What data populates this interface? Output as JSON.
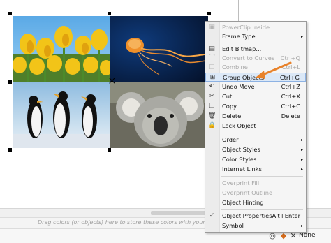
{
  "canvas": {
    "images": [
      {
        "name": "tulips"
      },
      {
        "name": "jellyfish"
      },
      {
        "name": "penguins"
      },
      {
        "name": "koala"
      }
    ]
  },
  "context_menu": {
    "items": [
      {
        "label": "PowerClip Inside...",
        "shortcut": "",
        "submenu": false,
        "disabled": true,
        "icon": "powerclip-icon"
      },
      {
        "label": "Frame Type",
        "shortcut": "",
        "submenu": true,
        "disabled": false,
        "icon": ""
      },
      {
        "label": "Edit Bitmap...",
        "shortcut": "",
        "submenu": false,
        "disabled": false,
        "icon": "edit-bitmap-icon"
      },
      {
        "label": "Convert to Curves",
        "shortcut": "Ctrl+Q",
        "submenu": false,
        "disabled": true,
        "icon": "convert-curves-icon"
      },
      {
        "label": "Combine",
        "shortcut": "Ctrl+L",
        "submenu": false,
        "disabled": true,
        "icon": "combine-icon"
      },
      {
        "label": "Group Objects",
        "shortcut": "Ctrl+G",
        "submenu": false,
        "disabled": false,
        "icon": "group-objects-icon",
        "highlighted": true
      },
      {
        "label": "Undo Move",
        "shortcut": "Ctrl+Z",
        "submenu": false,
        "disabled": false,
        "icon": "undo-icon"
      },
      {
        "label": "Cut",
        "shortcut": "Ctrl+X",
        "submenu": false,
        "disabled": false,
        "icon": "scissors-icon"
      },
      {
        "label": "Copy",
        "shortcut": "Ctrl+C",
        "submenu": false,
        "disabled": false,
        "icon": "copy-icon"
      },
      {
        "label": "Delete",
        "shortcut": "Delete",
        "submenu": false,
        "disabled": false,
        "icon": "trash-icon"
      },
      {
        "label": "Lock Object",
        "shortcut": "",
        "submenu": false,
        "disabled": false,
        "icon": "lock-icon"
      },
      {
        "label": "Order",
        "shortcut": "",
        "submenu": true,
        "disabled": false,
        "icon": ""
      },
      {
        "label": "Object Styles",
        "shortcut": "",
        "submenu": true,
        "disabled": false,
        "icon": ""
      },
      {
        "label": "Color Styles",
        "shortcut": "",
        "submenu": true,
        "disabled": false,
        "icon": ""
      },
      {
        "label": "Internet Links",
        "shortcut": "",
        "submenu": true,
        "disabled": false,
        "icon": ""
      },
      {
        "label": "Overprint Fill",
        "shortcut": "",
        "submenu": false,
        "disabled": true,
        "icon": ""
      },
      {
        "label": "Overprint Outline",
        "shortcut": "",
        "submenu": false,
        "disabled": true,
        "icon": ""
      },
      {
        "label": "Object Hinting",
        "shortcut": "",
        "submenu": false,
        "disabled": false,
        "icon": ""
      },
      {
        "label": "Object Properties",
        "shortcut": "Alt+Enter",
        "submenu": false,
        "disabled": false,
        "icon": "checkmark-icon",
        "checked": true
      },
      {
        "label": "Symbol",
        "shortcut": "",
        "submenu": true,
        "disabled": false,
        "icon": ""
      }
    ],
    "submenu_arrow": "▸"
  },
  "palette_bar": {
    "hint": "Drag colors (or objects) here to store these colors with your document"
  },
  "status_bar": {
    "fill_label": "None"
  },
  "colors": {
    "accent_arrow": "#e8822a",
    "highlight_bg": "#dbe8f7",
    "highlight_border": "#8db2e3"
  }
}
